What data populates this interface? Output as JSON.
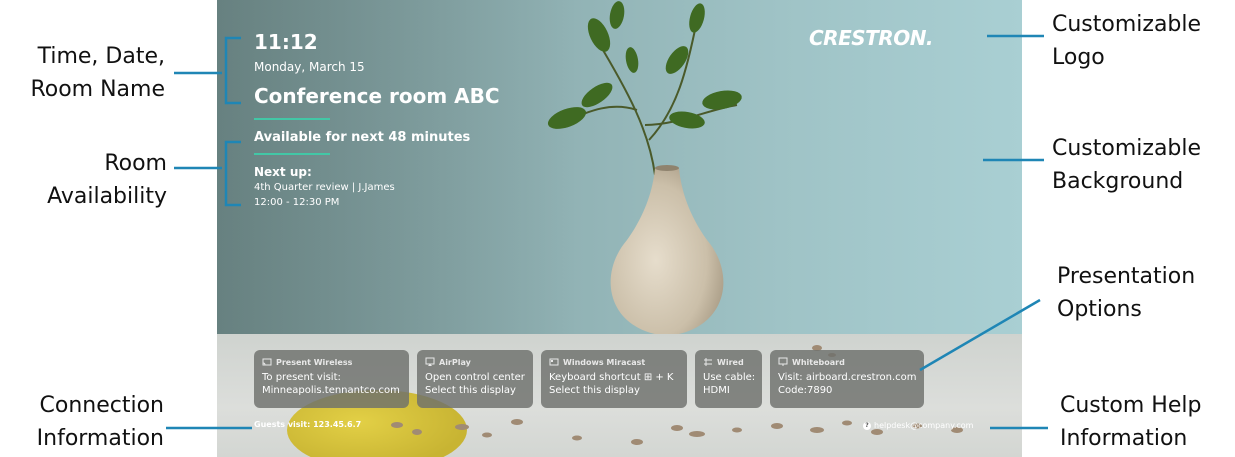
{
  "annotations": {
    "time_date_room": [
      "Time, Date,",
      "Room Name"
    ],
    "room_availability": [
      "Room",
      "Availability"
    ],
    "connection_information": [
      "Connection",
      "Information"
    ],
    "customizable_logo": [
      "Customizable",
      "Logo"
    ],
    "customizable_background": [
      "Customizable",
      "Background"
    ],
    "presentation_options": [
      "Presentation",
      "Options"
    ],
    "custom_help_information": [
      "Custom Help",
      "Information"
    ]
  },
  "screen": {
    "time": "11:12",
    "date": "Monday, March 15",
    "room_name": "Conference room ABC",
    "availability": "Available for next 48 minutes",
    "next_up_label": "Next up:",
    "next_up_title": "4th Quarter review | J.James",
    "next_up_time": "12:00 - 12:30 PM",
    "logo": "CRESTRON.",
    "guests": "Guests visit:  123.45.6.7",
    "help": "helpdesk@company.com"
  },
  "cards": [
    {
      "title": "Present Wireless",
      "icon": "cast-icon",
      "line1": "To present visit:",
      "line2": "Minneapolis.tennantco.com"
    },
    {
      "title": "AirPlay",
      "icon": "airplay-icon",
      "line1": "Open control center",
      "line2": "Select this display"
    },
    {
      "title": "Windows Miracast",
      "icon": "miracast-icon",
      "line1": "Keyboard shortcut ⊞ + K",
      "line2": "Select this display"
    },
    {
      "title": "Wired",
      "icon": "wired-icon",
      "line1": "Use cable:",
      "line2": "HDMI"
    },
    {
      "title": "Whiteboard",
      "icon": "whiteboard-icon",
      "line1": "Visit: airboard.crestron.com",
      "line2": "Code:7890"
    }
  ],
  "colors": {
    "accent_divider": "#42c7a6",
    "annotation_line": "#1f86b5",
    "card_bg": "#6e706c"
  }
}
